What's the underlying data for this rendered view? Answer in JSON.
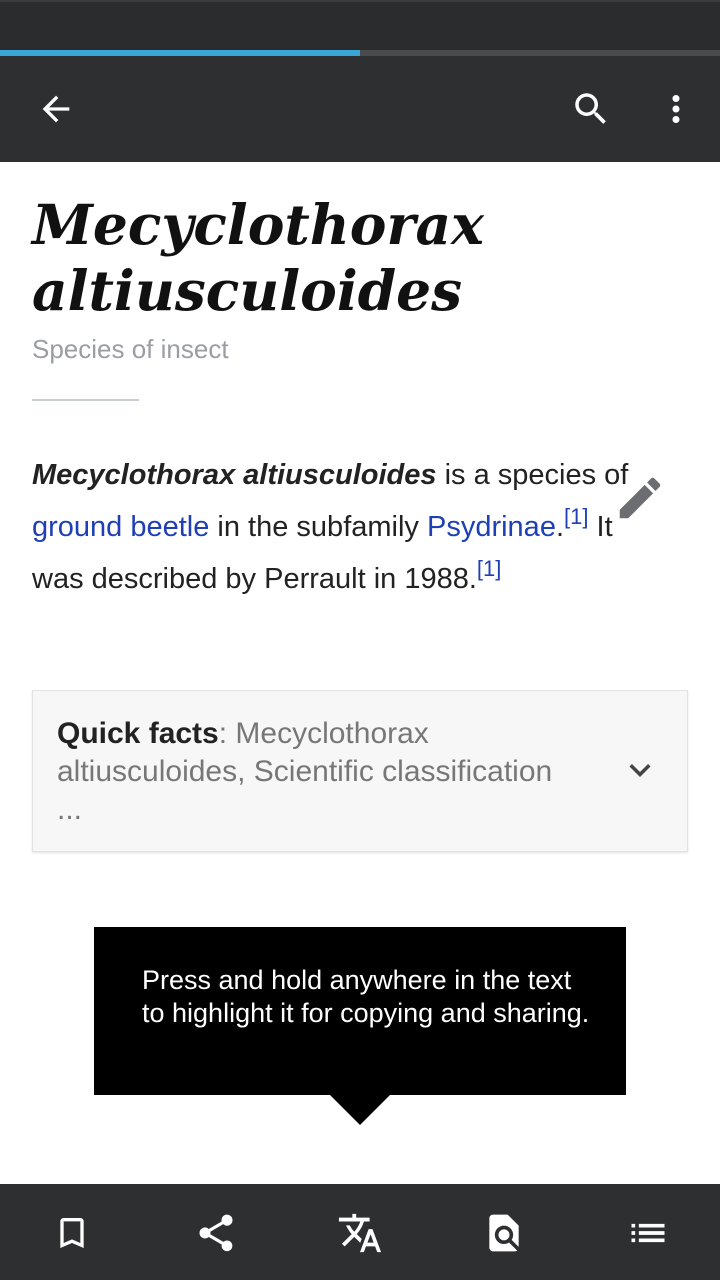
{
  "progress": {
    "fraction": 0.5
  },
  "toolbar": {
    "back_icon": "arrow-back-icon",
    "search_icon": "search-icon",
    "more_icon": "more-vert-icon"
  },
  "article": {
    "title_line1": "Mecyclothorax",
    "title_line2": "altiusculoides",
    "description": "Species of insect",
    "lead": {
      "name": "Mecyclothorax altiusculoides",
      "t1": " is a species of ",
      "link1": "ground beetle",
      "t2": " in the subfamily ",
      "link2": "Psydrinae",
      "t3": ".",
      "ref1": "[1]",
      "t4": " It was described by Perrault in 1988.",
      "ref2": "[1]"
    },
    "edit_icon": "pencil-icon"
  },
  "quick_facts": {
    "label": "Quick facts",
    "separator": ": ",
    "summary": "Mecyclothorax altiusculoides, Scientific classification ...",
    "chevron_icon": "chevron-down-icon"
  },
  "tooltip": {
    "text": "Press and hold anywhere in the text to highlight it for copying and sharing."
  },
  "bottom_bar": {
    "icons": [
      "bookmark-icon",
      "share-icon",
      "translate-icon",
      "find-in-page-icon",
      "contents-list-icon"
    ]
  },
  "colors": {
    "toolbar": "#2e2f31",
    "progress": "#3aa6d8",
    "link": "#1f3fb5",
    "tooltip": "#000000"
  }
}
